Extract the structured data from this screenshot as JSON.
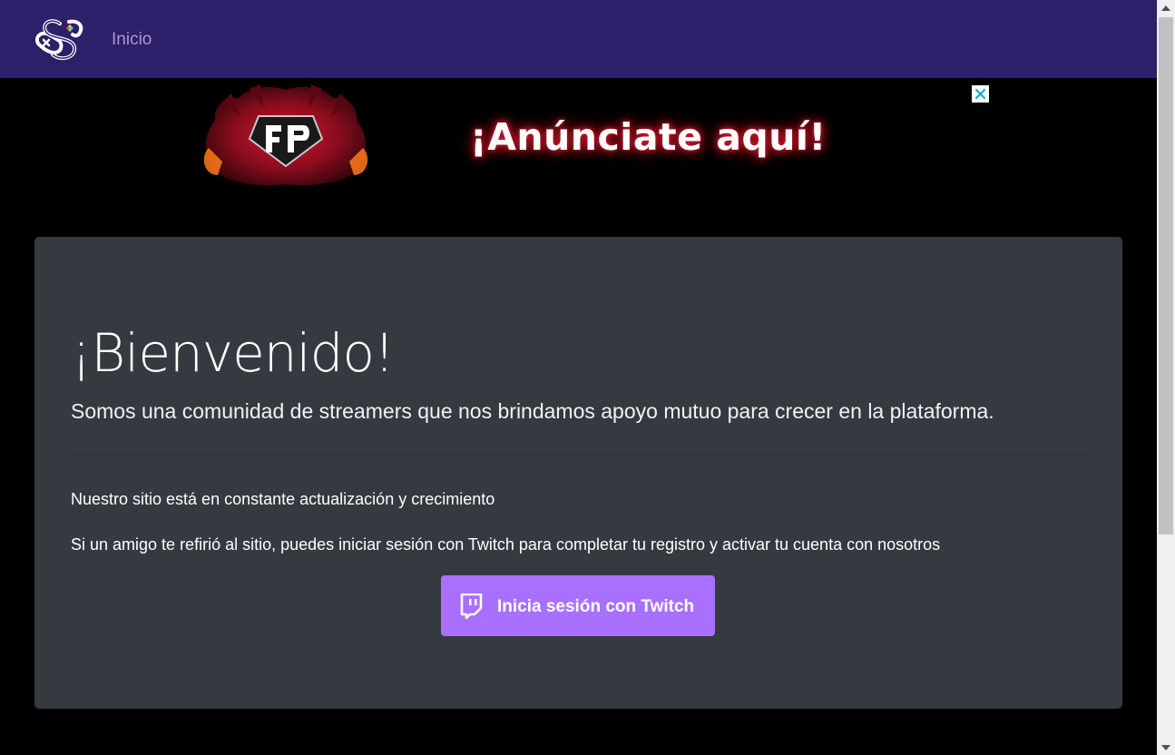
{
  "navbar": {
    "brand_icon": "gamepad-s-logo-icon",
    "links": [
      {
        "label": "Inicio"
      }
    ],
    "background": "#2d1f6a"
  },
  "ad": {
    "headline": "¡Anúnciate aquí!",
    "emblem_icon": "fp-dragon-emblem-icon",
    "close_icon": "close-icon",
    "glow_color": "#d01a2a"
  },
  "jumbotron": {
    "title": "¡Bienvenido!",
    "lead": "Somos una comunidad de streamers que nos brindamos apoyo mutuo para crecer en la plataforma.",
    "paragraphs": [
      "Nuestro sitio está en constante actualización y crecimiento",
      "Si un amigo te refirió al sitio, puedes iniciar sesión con Twitch para completar tu registro y activar tu cuenta con nosotros"
    ],
    "login_button": {
      "label": "Inicia sesión con Twitch",
      "icon": "twitch-icon",
      "color": "#a970ff"
    },
    "background": "#343a40"
  },
  "scrollbar": {
    "up_icon": "scroll-up-arrow-icon",
    "down_icon": "scroll-down-arrow-icon"
  }
}
